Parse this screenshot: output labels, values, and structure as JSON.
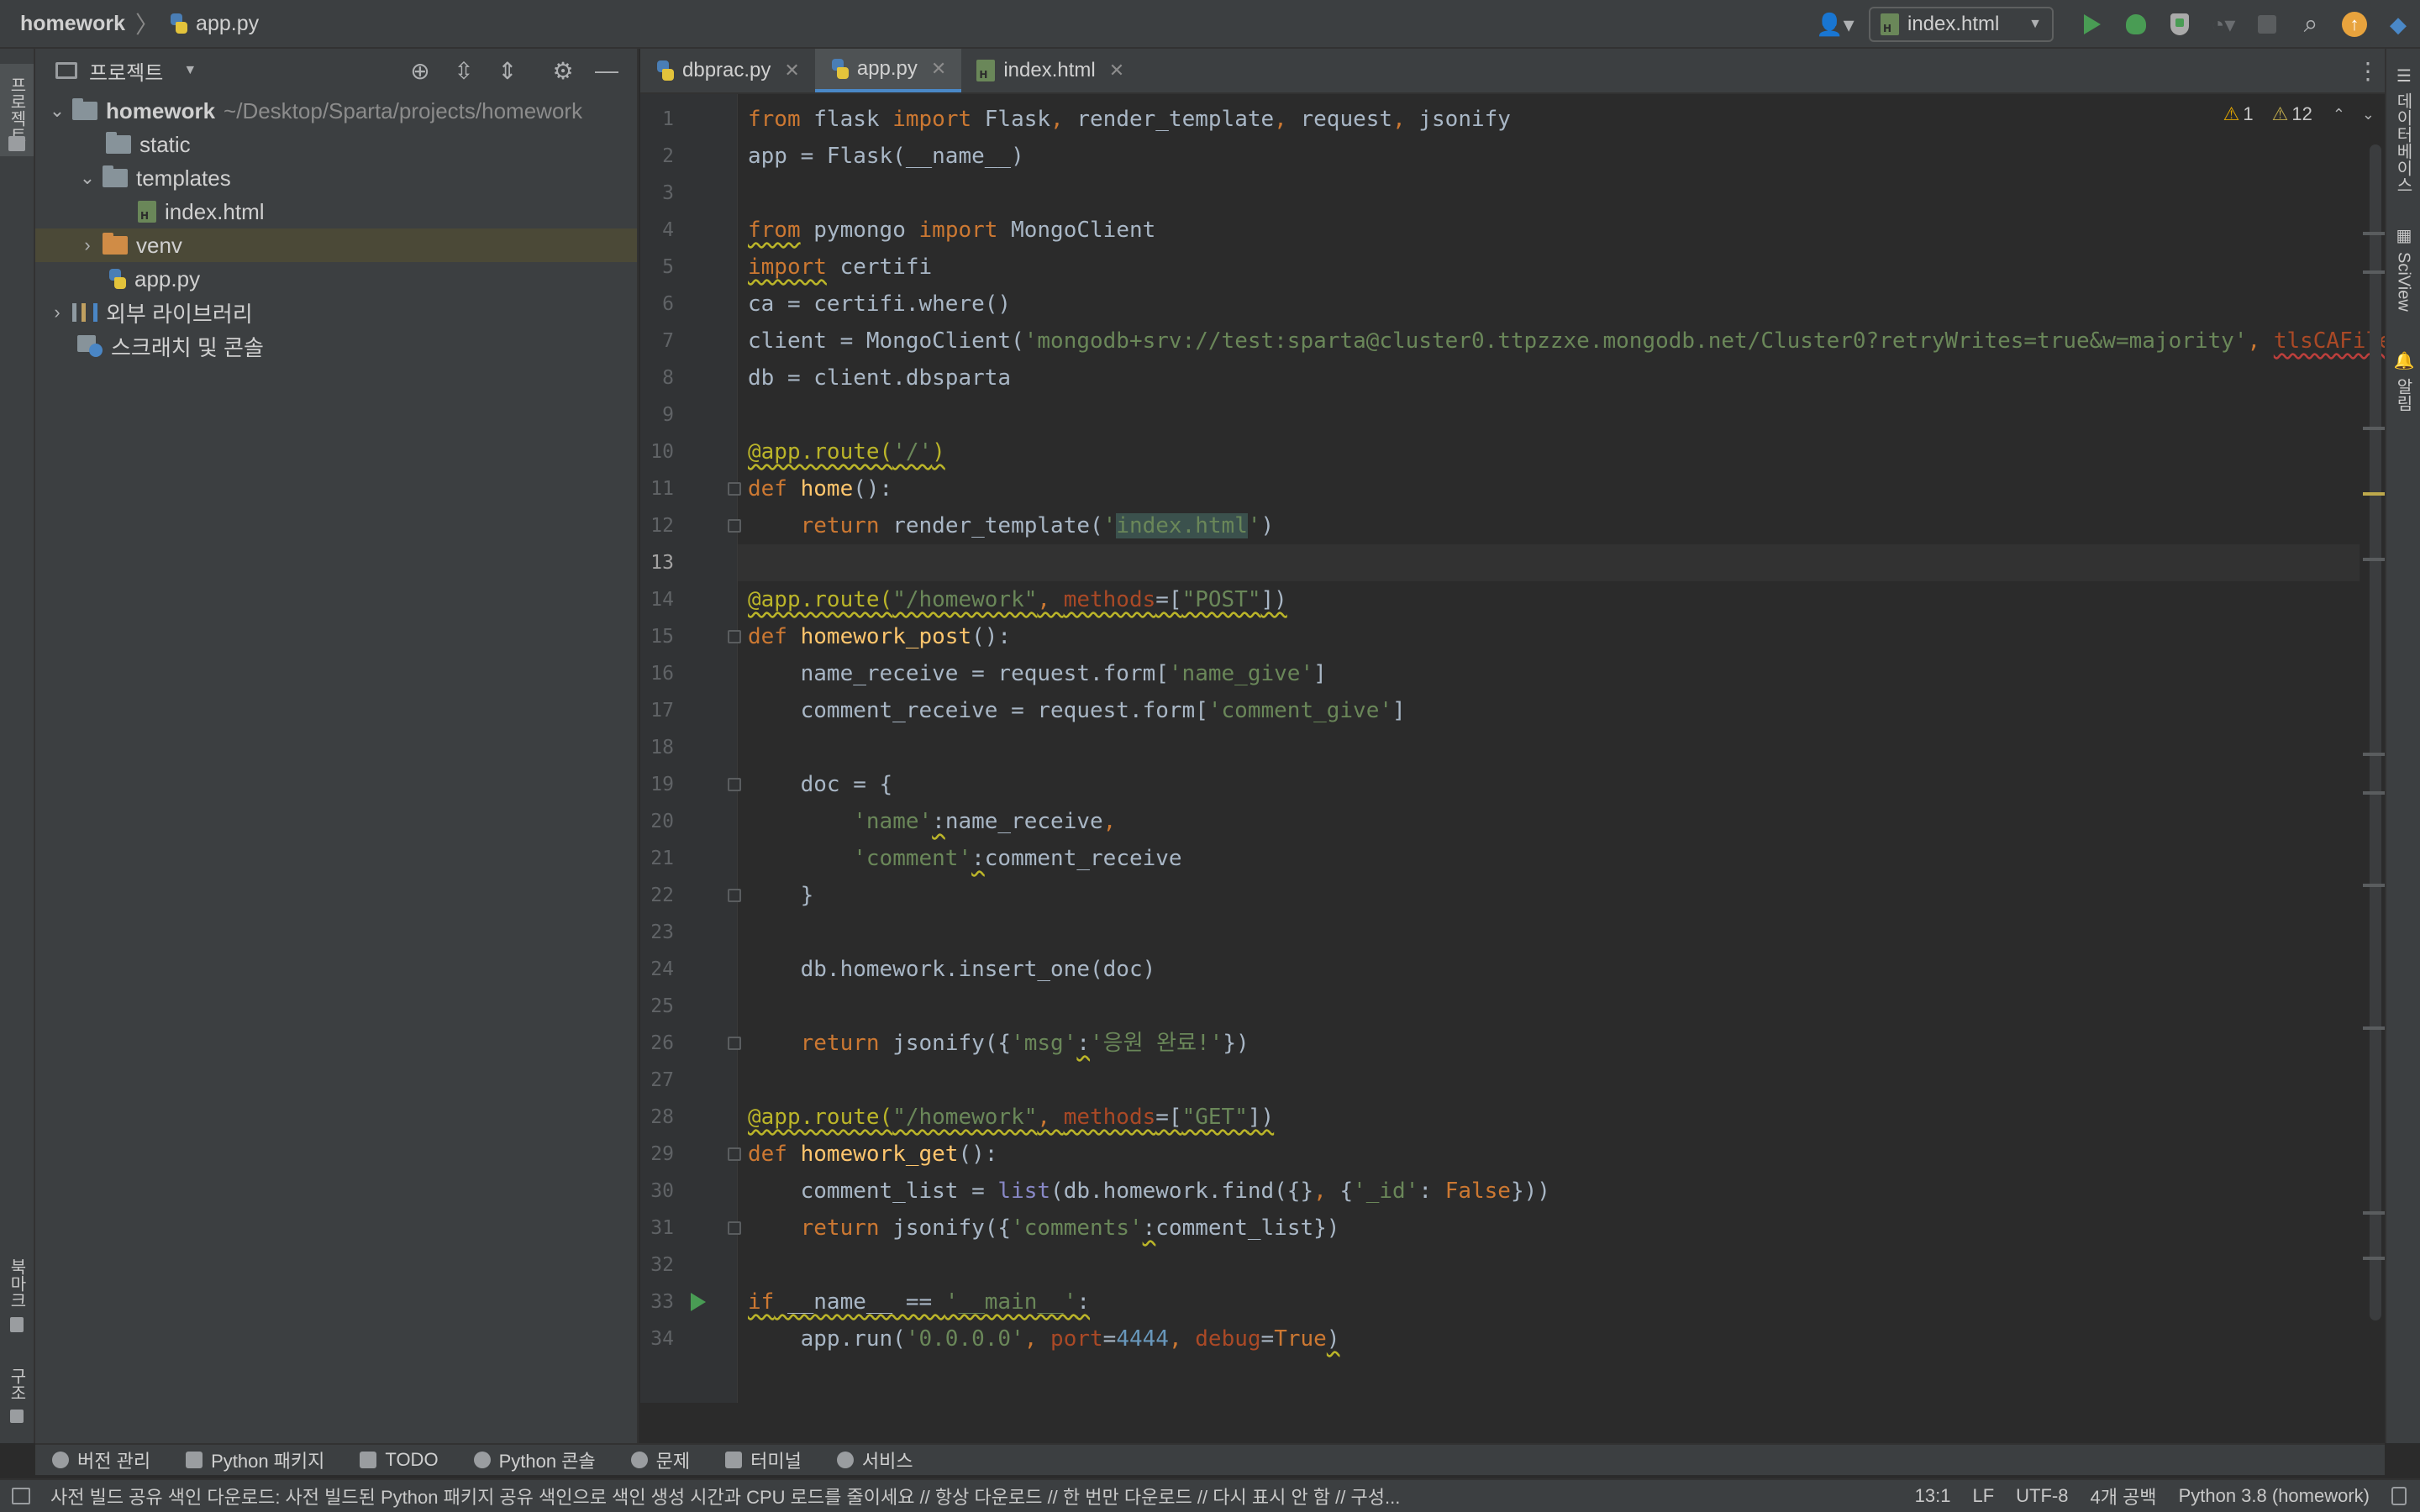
{
  "titlebar": {
    "project": "homework",
    "file": "app.py",
    "run_config": "index.html"
  },
  "left_strip": {
    "project_tab": "프로젝트",
    "bookmarks_tab": "북마크",
    "structure_tab": "구조"
  },
  "right_strip": {
    "database_tab": "데이터베이스",
    "sciview_tab": "SciView",
    "notifications_tab": "알림"
  },
  "project_panel": {
    "title": "프로젝트",
    "tree": [
      {
        "label": "homework",
        "path": "~/Desktop/Sparta/projects/homework"
      },
      {
        "label": "static"
      },
      {
        "label": "templates"
      },
      {
        "label": "index.html"
      },
      {
        "label": "venv"
      },
      {
        "label": "app.py"
      },
      {
        "label": "외부 라이브러리"
      },
      {
        "label": "스크래치 및 콘솔"
      }
    ]
  },
  "tabs": [
    {
      "label": "dbprac.py"
    },
    {
      "label": "app.py"
    },
    {
      "label": "index.html"
    }
  ],
  "inspection": {
    "errors": "1",
    "warnings": "12"
  },
  "editor": {
    "current_line": 13,
    "line_numbers": [
      "1",
      "2",
      "3",
      "4",
      "5",
      "6",
      "7",
      "8",
      "9",
      "10",
      "11",
      "12",
      "13",
      "14",
      "15",
      "16",
      "17",
      "18",
      "19",
      "20",
      "21",
      "22",
      "23",
      "24",
      "25",
      "26",
      "27",
      "28",
      "29",
      "30",
      "31",
      "32",
      "33",
      "34"
    ],
    "code": [
      [
        {
          "t": "from",
          "c": "kw"
        },
        {
          "t": " flask "
        },
        {
          "t": "import",
          "c": "kw"
        },
        {
          "t": " Flask"
        },
        {
          "t": ", ",
          "c": "kw"
        },
        {
          "t": "render_template"
        },
        {
          "t": ", ",
          "c": "kw"
        },
        {
          "t": "request"
        },
        {
          "t": ", ",
          "c": "kw"
        },
        {
          "t": "jsonify"
        }
      ],
      [
        {
          "t": "app = Flask(__name__)"
        }
      ],
      [],
      [
        {
          "t": "from",
          "c": "kw warn-u"
        },
        {
          "t": " pymongo "
        },
        {
          "t": "import",
          "c": "kw"
        },
        {
          "t": " MongoClient"
        }
      ],
      [
        {
          "t": "import",
          "c": "kw warn-u"
        },
        {
          "t": " certifi"
        }
      ],
      [
        {
          "t": "ca = certifi.where()"
        }
      ],
      [
        {
          "t": "client = MongoClient("
        },
        {
          "t": "'mongodb+srv://test:sparta@cluster0.ttpzzxe.mongodb.net/Cluster0?retryWrites=true&w=majority'",
          "c": "str"
        },
        {
          "t": ", ",
          "c": "kw"
        },
        {
          "t": "tlsCAFile",
          "c": "param err-u"
        }
      ],
      [
        {
          "t": "db = client.dbsparta"
        }
      ],
      [],
      [
        {
          "t": "@app.route(",
          "c": "deco warn-u"
        },
        {
          "t": "'/'",
          "c": "str warn-u"
        },
        {
          "t": ")",
          "c": "deco warn-u"
        }
      ],
      [
        {
          "t": "def",
          "c": "kw"
        },
        {
          "t": " "
        },
        {
          "t": "home",
          "c": "fn"
        },
        {
          "t": "():"
        }
      ],
      [
        {
          "t": "    "
        },
        {
          "t": "return",
          "c": "kw"
        },
        {
          "t": " render_template("
        },
        {
          "t": "'",
          "c": "str"
        },
        {
          "t": "index.html",
          "c": "str hl"
        },
        {
          "t": "'",
          "c": "str"
        },
        {
          "t": ")"
        }
      ],
      [],
      [
        {
          "t": "@app.route(",
          "c": "deco warn-u"
        },
        {
          "t": "\"/homework\"",
          "c": "str warn-u"
        },
        {
          "t": ", ",
          "c": "kw warn-u"
        },
        {
          "t": "methods",
          "c": "param warn-u"
        },
        {
          "t": "=[",
          "c": "warn-u"
        },
        {
          "t": "\"POST\"",
          "c": "str warn-u"
        },
        {
          "t": "])",
          "c": "warn-u"
        }
      ],
      [
        {
          "t": "def",
          "c": "kw"
        },
        {
          "t": " "
        },
        {
          "t": "homework_post",
          "c": "fn"
        },
        {
          "t": "():"
        }
      ],
      [
        {
          "t": "    name_receive = request.form["
        },
        {
          "t": "'name_give'",
          "c": "str"
        },
        {
          "t": "]"
        }
      ],
      [
        {
          "t": "    comment_receive = request.form["
        },
        {
          "t": "'comment_give'",
          "c": "str"
        },
        {
          "t": "]"
        }
      ],
      [],
      [
        {
          "t": "    doc = {"
        }
      ],
      [
        {
          "t": "        "
        },
        {
          "t": "'name'",
          "c": "str"
        },
        {
          "t": ":",
          "c": "warn-u"
        },
        {
          "t": "name_receive"
        },
        {
          "t": ",",
          "c": "kw"
        }
      ],
      [
        {
          "t": "        "
        },
        {
          "t": "'comment'",
          "c": "str"
        },
        {
          "t": ":",
          "c": "warn-u"
        },
        {
          "t": "comment_receive"
        }
      ],
      [
        {
          "t": "    }"
        }
      ],
      [],
      [
        {
          "t": "    db.homework.insert_one(doc)"
        }
      ],
      [],
      [
        {
          "t": "    "
        },
        {
          "t": "return",
          "c": "kw"
        },
        {
          "t": " jsonify({"
        },
        {
          "t": "'msg'",
          "c": "str"
        },
        {
          "t": ":",
          "c": "warn-u"
        },
        {
          "t": "'응원 완료!'",
          "c": "str"
        },
        {
          "t": "})"
        }
      ],
      [],
      [
        {
          "t": "@app.route(",
          "c": "deco warn-u"
        },
        {
          "t": "\"/homework\"",
          "c": "str warn-u"
        },
        {
          "t": ", ",
          "c": "kw warn-u"
        },
        {
          "t": "methods",
          "c": "param warn-u"
        },
        {
          "t": "=[",
          "c": "warn-u"
        },
        {
          "t": "\"GET\"",
          "c": "str warn-u"
        },
        {
          "t": "])",
          "c": "warn-u"
        }
      ],
      [
        {
          "t": "def",
          "c": "kw"
        },
        {
          "t": " "
        },
        {
          "t": "homework_get",
          "c": "fn"
        },
        {
          "t": "():"
        }
      ],
      [
        {
          "t": "    comment_list = "
        },
        {
          "t": "list",
          "c": "bi"
        },
        {
          "t": "(db.homework.find({}"
        },
        {
          "t": ", ",
          "c": "kw"
        },
        {
          "t": "{"
        },
        {
          "t": "'_id'",
          "c": "str"
        },
        {
          "t": ": "
        },
        {
          "t": "False",
          "c": "kw"
        },
        {
          "t": "}))"
        }
      ],
      [
        {
          "t": "    "
        },
        {
          "t": "return",
          "c": "kw"
        },
        {
          "t": " jsonify({"
        },
        {
          "t": "'comments'",
          "c": "str"
        },
        {
          "t": ":",
          "c": "warn-u"
        },
        {
          "t": "comment_list})"
        }
      ],
      [],
      [
        {
          "t": "if",
          "c": "kw warn-u"
        },
        {
          "t": " __name__ == ",
          "c": "warn-u"
        },
        {
          "t": "'__main__'",
          "c": "str warn-u"
        },
        {
          "t": ":",
          "c": "warn-u"
        }
      ],
      [
        {
          "t": "    app.run("
        },
        {
          "t": "'0.0.0.0'",
          "c": "str"
        },
        {
          "t": ", ",
          "c": "kw"
        },
        {
          "t": "port",
          "c": "param"
        },
        {
          "t": "="
        },
        {
          "t": "4444",
          "c": "num"
        },
        {
          "t": ", ",
          "c": "kw"
        },
        {
          "t": "debug",
          "c": "param"
        },
        {
          "t": "="
        },
        {
          "t": "True",
          "c": "kw"
        },
        {
          "t": ")",
          "c": "warn-u"
        }
      ]
    ]
  },
  "bottom_tools": [
    {
      "label": "버전 관리"
    },
    {
      "label": "Python 패키지"
    },
    {
      "label": "TODO"
    },
    {
      "label": "Python 콘솔"
    },
    {
      "label": "문제"
    },
    {
      "label": "터미널"
    },
    {
      "label": "서비스"
    }
  ],
  "statusbar": {
    "message": "사전 빌드 공유 색인 다운로드: 사전 빌드된 Python 패키지 공유 색인으로 색인 생성 시간과 CPU 로드를 줄이세요 // 항상 다운로드 // 한 번만 다운로드 // 다시 표시 안 함 // 구성...",
    "position": "13:1",
    "line_sep": "LF",
    "encoding": "UTF-8",
    "indent": "4개 공백",
    "interpreter": "Python 3.8 (homework)"
  },
  "colors": {
    "keyword": "#cc7832",
    "string": "#6a8759",
    "decorator": "#bbb529",
    "function": "#ffc66d",
    "number": "#6897bb",
    "param": "#aa4926",
    "run_green": "#499c54",
    "tab_accent": "#4a88c7"
  }
}
